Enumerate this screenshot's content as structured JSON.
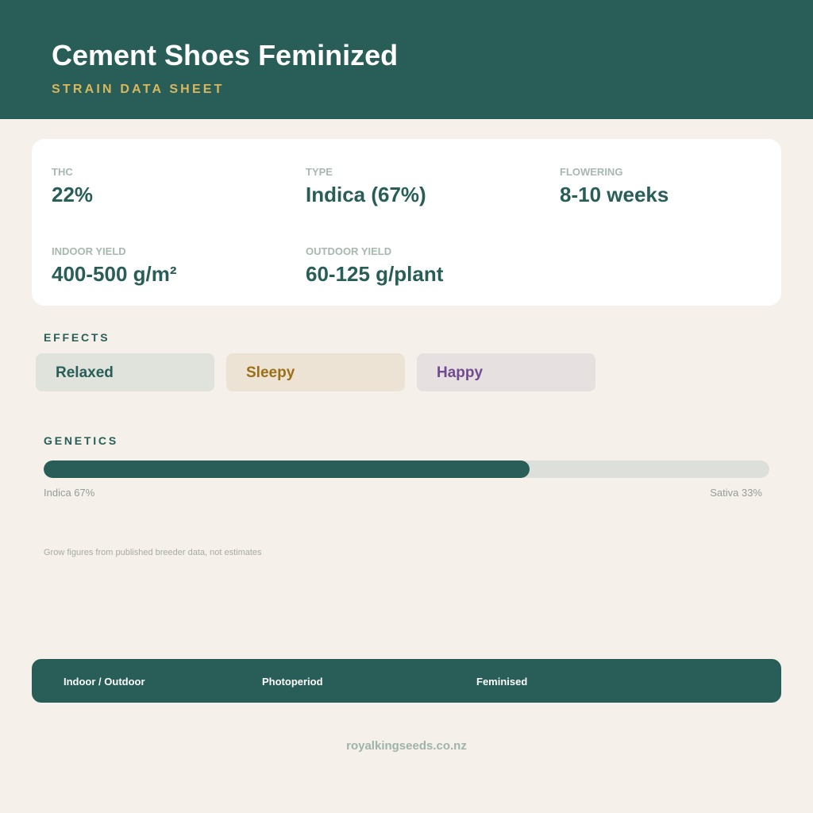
{
  "header": {
    "title": "Cement Shoes Feminized",
    "subtitle": "STRAIN DATA SHEET"
  },
  "stats": {
    "thc": {
      "label": "THC",
      "value": "22%"
    },
    "type": {
      "label": "TYPE",
      "value": "Indica (67%)"
    },
    "flowering": {
      "label": "FLOWERING",
      "value": "8-10 weeks"
    },
    "indoor_yield": {
      "label": "INDOOR YIELD",
      "value": "400-500 g/m²"
    },
    "outdoor_yield": {
      "label": "OUTDOOR YIELD",
      "value": "60-125 g/plant"
    }
  },
  "effects": {
    "heading": "EFFECTS",
    "items": [
      {
        "label": "Relaxed",
        "text_color": "#285e57",
        "bg_color": "#e0e2dc"
      },
      {
        "label": "Sleepy",
        "text_color": "#9a6f16",
        "bg_color": "#ede3d5"
      },
      {
        "label": "Happy",
        "text_color": "#6f4a8e",
        "bg_color": "#e7e0e0"
      }
    ]
  },
  "genetics": {
    "heading": "GENETICS",
    "indica_percent": 67,
    "sativa_percent": 33,
    "indica_label": "Indica 67%",
    "sativa_label": "Sativa 33%"
  },
  "note": "Grow figures from published breeder data, not estimates",
  "tags": [
    "Indoor / Outdoor",
    "Photoperiod",
    "Feminised"
  ],
  "footer": {
    "site": "royalkingseeds.co.nz"
  },
  "colors": {
    "primary": "#285e57",
    "accent": "#d8b75e",
    "background": "#f5f0ea"
  }
}
